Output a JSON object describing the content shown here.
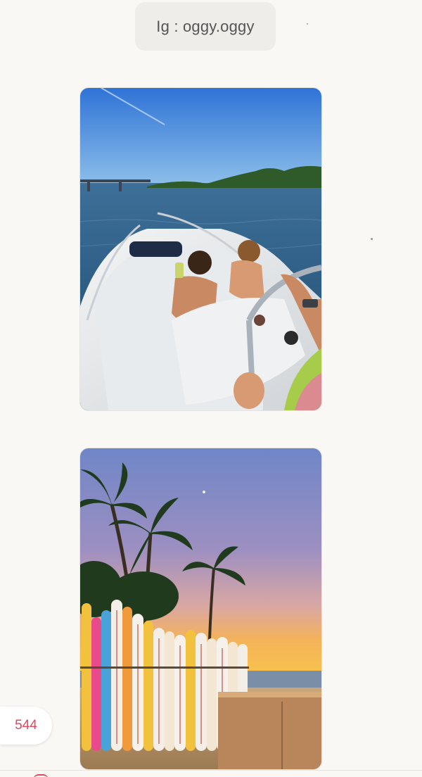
{
  "post": {
    "caption": "Ig : oggy.oggy",
    "like_count": "544"
  },
  "photos": [
    {
      "subject": "boat-on-lake"
    },
    {
      "subject": "beach-surfboards-sunset"
    }
  ],
  "colors": {
    "background": "#faf8f5",
    "chip": "#efedea",
    "accent": "#e0485d"
  }
}
